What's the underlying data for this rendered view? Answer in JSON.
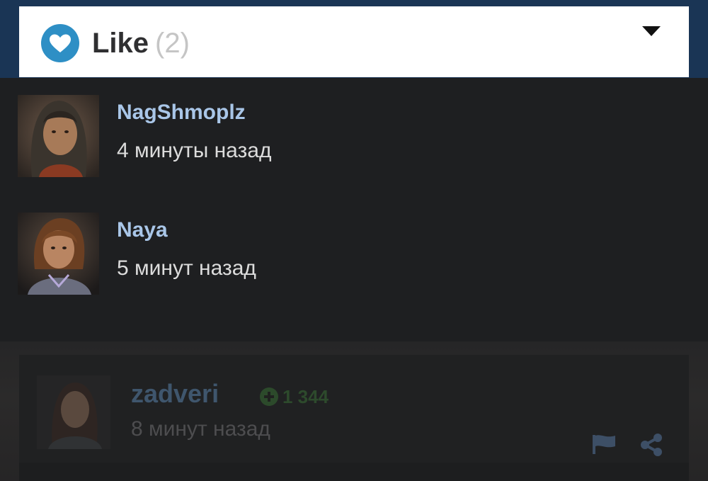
{
  "header": {
    "like_label": "Like",
    "like_count": "(2)",
    "heart_icon": "heart-icon",
    "caret_icon": "caret-down-icon",
    "accent_color": "#2e8fc5"
  },
  "likers": [
    {
      "name": "NagShmoplz",
      "time": "4 минуты назад"
    },
    {
      "name": "Naya",
      "time": "5 минут назад"
    }
  ],
  "comment": {
    "author": "zadveri",
    "reputation": "1 344",
    "time": "8 минут назад",
    "flag_icon": "flag-icon",
    "share_icon": "share-icon"
  }
}
